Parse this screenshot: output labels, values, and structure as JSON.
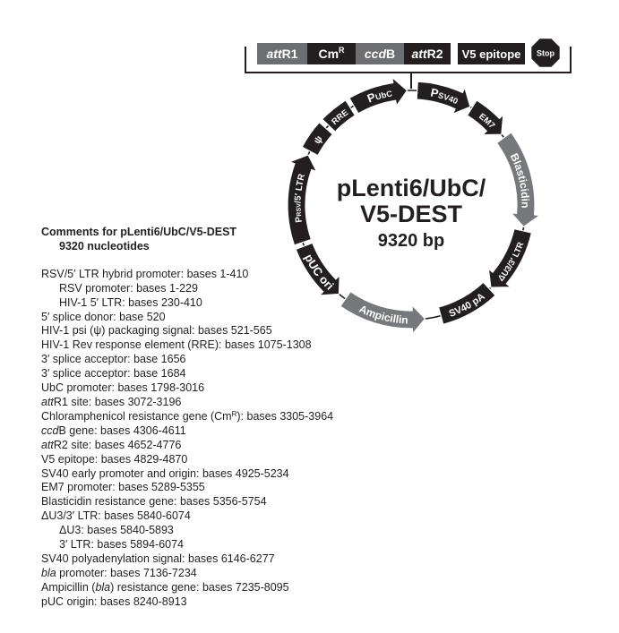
{
  "plasmid": {
    "name_line1": "pLenti6/UbC/",
    "name_line2": "V5-DEST",
    "size": "9320 bp",
    "colors": {
      "black_feature": "#231f20",
      "gray_feature": "#77787b",
      "gray_box": "#6d6e71",
      "text": "#231f20"
    }
  },
  "cassette": {
    "boxes": [
      {
        "label_italic": "att",
        "label": "R1",
        "sup": "",
        "fill": "gray"
      },
      {
        "label_italic": "",
        "label": "Cm",
        "sup": "R",
        "fill": "black"
      },
      {
        "label_italic": "ccd",
        "label": "B",
        "sup": "",
        "fill": "gray"
      },
      {
        "label_italic": "att",
        "label": "R2",
        "sup": "",
        "fill": "black"
      }
    ],
    "v5_label": "V5 epitope",
    "stop_label": "Stop"
  },
  "features": [
    {
      "id": "psv40",
      "label": "P",
      "sub": "SV40",
      "fill": "black",
      "start": 3,
      "end": 31,
      "dir": "cw"
    },
    {
      "id": "em7",
      "label": "EM7",
      "sub": "",
      "fill": "black",
      "start": 32,
      "end": 52,
      "dir": "cw"
    },
    {
      "id": "blasticidin",
      "label": "Blasticidin",
      "sub": "",
      "fill": "gray",
      "start": 54,
      "end": 101,
      "dir": "cw"
    },
    {
      "id": "du3-3ltr",
      "label": "ΔU3/3′ LTR",
      "sub": "",
      "fill": "black",
      "start": 103,
      "end": 136,
      "dir": "cw"
    },
    {
      "id": "sv40pa",
      "label": "SV40 pA",
      "sub": "",
      "fill": "black",
      "start": 137,
      "end": 165,
      "dir": "none"
    },
    {
      "id": "ampicillin",
      "label": "Ampicillin",
      "sub": "",
      "fill": "gray",
      "start": 173,
      "end": 215,
      "dir": "ccw"
    },
    {
      "id": "puc-ori",
      "label": "pUC ori",
      "sub": "",
      "fill": "black",
      "start": 219,
      "end": 249,
      "dir": "ccw"
    },
    {
      "id": "prsv-5ltr",
      "label": "P",
      "sub": "RSV",
      "label2": "/5′ LTR",
      "fill": "black",
      "start": 251,
      "end": 296,
      "dir": "cw"
    },
    {
      "id": "psi",
      "label": "ψ",
      "sub": "",
      "fill": "black",
      "start": 298,
      "end": 312,
      "dir": "none"
    },
    {
      "id": "rre",
      "label": "RRE",
      "sub": "",
      "fill": "black",
      "start": 314,
      "end": 328,
      "dir": "none"
    },
    {
      "id": "pubc",
      "label": "P",
      "sub": "UbC",
      "fill": "black",
      "start": 330,
      "end": 358,
      "dir": "cw"
    }
  ],
  "comments": {
    "title": "Comments for pLenti6/UbC/V5-DEST",
    "subtitle": "9320 nucleotides",
    "lines": [
      {
        "indent": 0,
        "pre_i": "",
        "text": "RSV/5′ LTR hybrid promoter: bases 1-410"
      },
      {
        "indent": 1,
        "pre_i": "",
        "text": "RSV promoter: bases 1-229"
      },
      {
        "indent": 1,
        "pre_i": "",
        "text": "HIV-1 5′ LTR: bases 230-410"
      },
      {
        "indent": 0,
        "pre_i": "",
        "text": "5′ splice donor: base 520"
      },
      {
        "indent": 0,
        "pre_i": "",
        "text": "HIV-1 psi (ψ) packaging signal: bases 521-565"
      },
      {
        "indent": 0,
        "pre_i": "",
        "text": "HIV-1 Rev response element (RRE): bases 1075-1308"
      },
      {
        "indent": 0,
        "pre_i": "",
        "text": "3′ splice acceptor: base 1656"
      },
      {
        "indent": 0,
        "pre_i": "",
        "text": "3′ splice acceptor: base 1684"
      },
      {
        "indent": 0,
        "pre_i": "",
        "text": "UbC promoter: bases 1798-3016"
      },
      {
        "indent": 0,
        "pre_i": "att",
        "text": "R1 site: bases 3072-3196"
      },
      {
        "indent": 0,
        "pre_i": "",
        "text": "Chloramphenicol resistance gene (Cm",
        "sup": "R",
        "post": "): bases 3305-3964"
      },
      {
        "indent": 0,
        "pre_i": "ccd",
        "text": "B gene: bases 4306-4611"
      },
      {
        "indent": 0,
        "pre_i": "att",
        "text": "R2 site: bases 4652-4776"
      },
      {
        "indent": 0,
        "pre_i": "",
        "text": "V5 epitope: bases 4829-4870"
      },
      {
        "indent": 0,
        "pre_i": "",
        "text": "SV40 early promoter and origin: bases 4925-5234"
      },
      {
        "indent": 0,
        "pre_i": "",
        "text": "EM7 promoter: bases 5289-5355"
      },
      {
        "indent": 0,
        "pre_i": "",
        "text": "Blasticidin resistance gene: bases 5356-5754"
      },
      {
        "indent": 0,
        "pre_i": "",
        "text": "ΔU3/3′ LTR: bases 5840-6074"
      },
      {
        "indent": 1,
        "pre_i": "",
        "text": "ΔU3: bases 5840-5893"
      },
      {
        "indent": 1,
        "pre_i": "",
        "text": "3′ LTR: bases 5894-6074"
      },
      {
        "indent": 0,
        "pre_i": "",
        "text": "SV40 polyadenylation signal: bases 6146-6277"
      },
      {
        "indent": 0,
        "pre_i": "bla",
        "text": " promoter: bases 7136-7234"
      },
      {
        "indent": 0,
        "pre_i": "",
        "text": "Ampicillin (",
        "mid_i": "bla",
        "post": ") resistance gene: bases 7235-8095"
      },
      {
        "indent": 0,
        "pre_i": "",
        "text": "pUC origin: bases 8240-8913"
      }
    ]
  }
}
